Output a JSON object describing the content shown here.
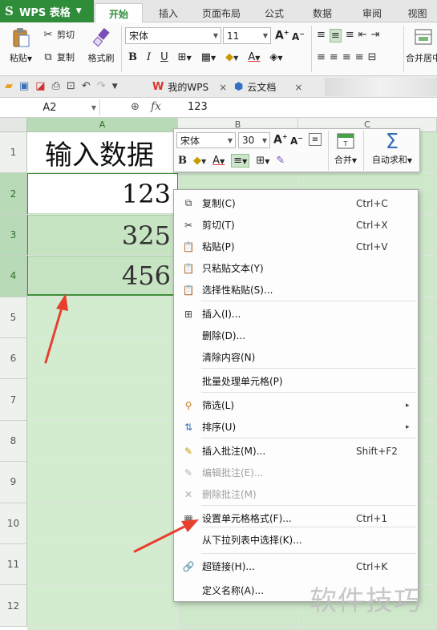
{
  "app": {
    "name": "WPS 表格",
    "logo": "S"
  },
  "ribbon_tabs": [
    "开始",
    "插入",
    "页面布局",
    "公式",
    "数据",
    "审阅",
    "视图"
  ],
  "ribbon": {
    "cut": "剪切",
    "paste": "粘贴",
    "copy": "复制",
    "format_painter": "格式刷",
    "font_name": "宋体",
    "font_size": "11",
    "merge_center": "合并居中"
  },
  "doc_tabs": [
    {
      "label": "我的WPS",
      "icon": "wps-logo-icon"
    },
    {
      "label": "云文档",
      "icon": "cloud-doc-icon"
    }
  ],
  "formula_bar": {
    "cell_ref": "A2",
    "fx": "fx",
    "value": "123"
  },
  "columns": [
    "A",
    "B",
    "C"
  ],
  "rows": [
    "1",
    "2",
    "3",
    "4",
    "5",
    "6",
    "7",
    "8",
    "9",
    "10",
    "11",
    "12"
  ],
  "cells": {
    "A1": "输入数据",
    "A2": "123",
    "A3": "325",
    "A4": "456"
  },
  "mini_toolbar": {
    "font_name": "宋体",
    "font_size": "30",
    "merge": "合并",
    "autosum": "自动求和"
  },
  "context_menu": [
    {
      "label": "复制(C)",
      "shortcut": "Ctrl+C",
      "icon": "copy-icon",
      "enabled": true
    },
    {
      "label": "剪切(T)",
      "shortcut": "Ctrl+X",
      "icon": "scissors-icon",
      "enabled": true
    },
    {
      "label": "粘贴(P)",
      "shortcut": "Ctrl+V",
      "icon": "paste-icon",
      "enabled": true
    },
    {
      "label": "只粘贴文本(Y)",
      "shortcut": "",
      "icon": "paste-text-icon",
      "enabled": true
    },
    {
      "label": "选择性粘贴(S)...",
      "shortcut": "",
      "icon": "paste-special-icon",
      "enabled": true
    },
    {
      "label": "插入(I)...",
      "shortcut": "",
      "icon": "insert-cells-icon",
      "enabled": true
    },
    {
      "label": "删除(D)...",
      "shortcut": "",
      "icon": "",
      "enabled": true
    },
    {
      "label": "清除内容(N)",
      "shortcut": "",
      "icon": "",
      "enabled": true
    },
    {
      "label": "批量处理单元格(P)",
      "shortcut": "",
      "icon": "",
      "enabled": true
    },
    {
      "label": "筛选(L)",
      "shortcut": "",
      "icon": "filter-icon",
      "enabled": true,
      "submenu": true
    },
    {
      "label": "排序(U)",
      "shortcut": "",
      "icon": "sort-icon",
      "enabled": true,
      "submenu": true
    },
    {
      "label": "插入批注(M)...",
      "shortcut": "Shift+F2",
      "icon": "insert-comment-icon",
      "enabled": true
    },
    {
      "label": "编辑批注(E)...",
      "shortcut": "",
      "icon": "edit-comment-icon",
      "enabled": false
    },
    {
      "label": "删除批注(M)",
      "shortcut": "",
      "icon": "delete-comment-icon",
      "enabled": false
    },
    {
      "label": "设置单元格格式(F)...",
      "shortcut": "Ctrl+1",
      "icon": "format-cells-icon",
      "enabled": true
    },
    {
      "label": "从下拉列表中选择(K)...",
      "shortcut": "",
      "icon": "",
      "enabled": true
    },
    {
      "label": "超链接(H)...",
      "shortcut": "Ctrl+K",
      "icon": "hyperlink-icon",
      "enabled": true
    },
    {
      "label": "定义名称(A)...",
      "shortcut": "",
      "icon": "",
      "enabled": true
    }
  ],
  "watermark": "软件技巧",
  "colors": {
    "brand_green": "#2f8d3a",
    "selection_fill": "#c6e3c2",
    "annotation_red": "#e8402f"
  }
}
